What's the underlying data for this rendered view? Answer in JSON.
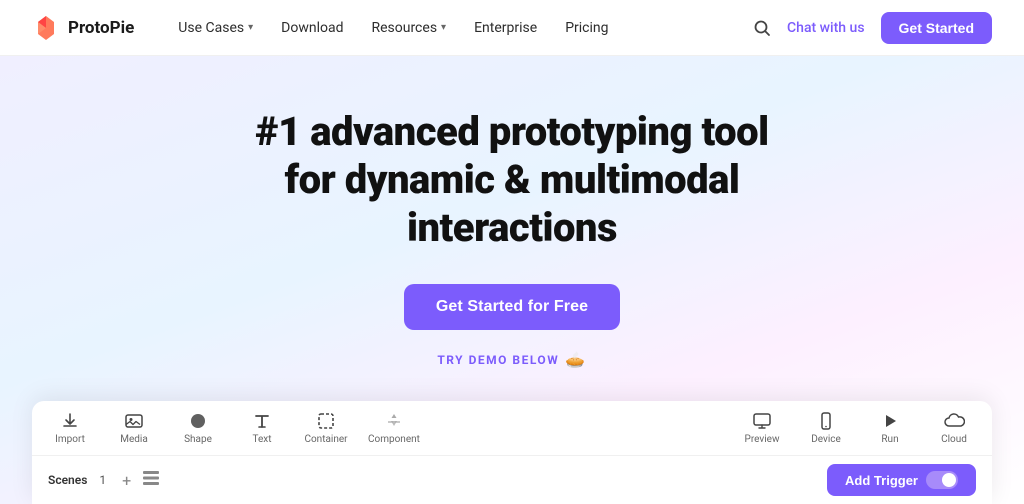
{
  "brand": {
    "name": "ProtoPie",
    "logo_alt": "ProtoPie logo"
  },
  "navbar": {
    "links": [
      {
        "id": "use-cases",
        "label": "Use Cases",
        "has_dropdown": true
      },
      {
        "id": "download",
        "label": "Download",
        "has_dropdown": false
      },
      {
        "id": "resources",
        "label": "Resources",
        "has_dropdown": true
      },
      {
        "id": "enterprise",
        "label": "Enterprise",
        "has_dropdown": false
      },
      {
        "id": "pricing",
        "label": "Pricing",
        "has_dropdown": false
      }
    ],
    "chat_label": "Chat with us",
    "get_started_label": "Get Started"
  },
  "hero": {
    "title_line1": "#1 advanced prototyping tool",
    "title_line2": "for dynamic & multimodal",
    "title_line3": "interactions",
    "cta_label": "Get Started for Free",
    "try_demo_label": "TRY DEMO BELOW"
  },
  "demo_toolbar": {
    "left_items": [
      {
        "id": "import",
        "label": "Import",
        "icon": "⬇"
      },
      {
        "id": "media",
        "label": "Media",
        "icon": "🖼"
      },
      {
        "id": "shape",
        "label": "Shape",
        "icon": "⬤"
      },
      {
        "id": "text",
        "label": "Text",
        "icon": "T"
      },
      {
        "id": "container",
        "label": "Container",
        "icon": "⬜"
      },
      {
        "id": "component",
        "label": "Component",
        "icon": "⚡"
      }
    ],
    "right_items": [
      {
        "id": "preview",
        "label": "Preview",
        "icon": "⬛"
      },
      {
        "id": "device",
        "label": "Device",
        "icon": "📱"
      },
      {
        "id": "run",
        "label": "Run",
        "icon": "▶"
      },
      {
        "id": "cloud",
        "label": "Cloud",
        "icon": "☁"
      }
    ]
  },
  "demo_bottom": {
    "scenes_label": "Scenes",
    "scenes_count": "1",
    "add_trigger_label": "Add Trigger"
  },
  "colors": {
    "brand_purple": "#7c5cfc",
    "nav_text": "#2d2d2d",
    "hero_text": "#111111"
  }
}
